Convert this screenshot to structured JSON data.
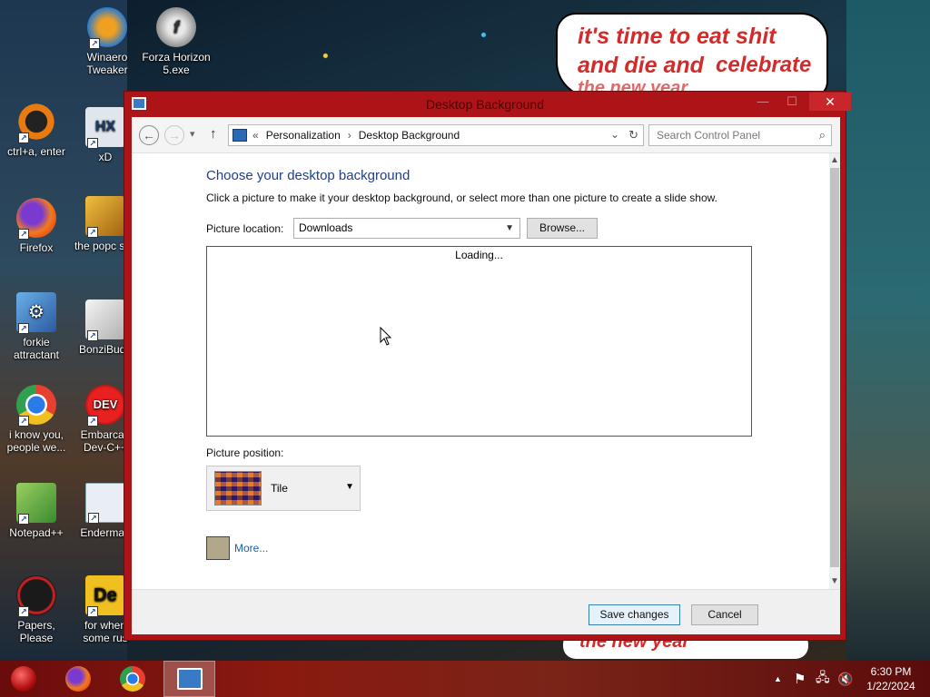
{
  "desktop": {
    "meme_text_line1": "it's time to eat shit",
    "meme_text_line2": "and die and",
    "meme_text_line2b": "celebrate",
    "meme_text_line3": "the new year",
    "meme_bottom_text": "the new year",
    "icons": [
      {
        "label": "Winaero Tweaker",
        "icon": "winaero-icon"
      },
      {
        "label": "Forza Horizon 5.exe",
        "icon": "flash-icon"
      },
      {
        "label": "ctrl+a, enter",
        "icon": "ring-icon"
      },
      {
        "label": "xD",
        "icon": "hxd-icon"
      },
      {
        "label": "Firefox",
        "icon": "firefox-icon"
      },
      {
        "label": "the popc shit",
        "icon": "folder-icon"
      },
      {
        "label": "forkie attractant",
        "icon": "settings-icon"
      },
      {
        "label": "BonziBudd",
        "icon": "bonzi-icon"
      },
      {
        "label": "i know you, people we...",
        "icon": "chrome-icon"
      },
      {
        "label": "Embarcad Dev-C++",
        "icon": "devcpp-icon"
      },
      {
        "label": "Notepad++",
        "icon": "notepad-icon"
      },
      {
        "label": "Enderman",
        "icon": "app-icon"
      },
      {
        "label": "Papers, Please",
        "icon": "papers-icon"
      },
      {
        "label": "for when some rus",
        "icon": "de-icon"
      }
    ]
  },
  "window": {
    "title": "Desktop Background",
    "close_glyph": "✕",
    "minimize_glyph": "—",
    "maximize_glyph": "☐",
    "nav": {
      "back_glyph": "←",
      "forward_glyph": "→",
      "recent_glyph": "▾",
      "up_glyph": "↑",
      "address_prefix": "«",
      "breadcrumb": [
        "Personalization",
        "Desktop Background"
      ],
      "breadcrumb_sep": "›",
      "dropdown_glyph": "⌄",
      "refresh_glyph": "↻",
      "search_placeholder": "Search Control Panel",
      "search_glyph": "⌕"
    },
    "heading": "Choose your desktop background",
    "description": "Click a picture to make it your desktop background, or select more than one picture to create a slide show.",
    "picture_location_label": "Picture location:",
    "picture_location_value": "Downloads",
    "browse_label": "Browse...",
    "gallery_status": "Loading...",
    "picture_position_label": "Picture position:",
    "picture_position_value": "Tile",
    "more_label": "More...",
    "swatch_color": "#b0a888",
    "save_label": "Save changes",
    "cancel_label": "Cancel"
  },
  "taskbar": {
    "items": [
      {
        "name": "start-button",
        "icon": "start-ornament-icon"
      },
      {
        "name": "firefox",
        "icon": "firefox-icon"
      },
      {
        "name": "chrome",
        "icon": "chrome-icon"
      },
      {
        "name": "control-panel",
        "icon": "control-panel-icon",
        "active": true
      }
    ],
    "tray_glyphs": {
      "up": "▲",
      "flag": "⚑",
      "network": "🖧",
      "volume": "🔇"
    },
    "time": "6:30 PM",
    "date": "1/22/2024"
  },
  "colors": {
    "window_frame": "#ad1418",
    "heading": "#1e3f8a",
    "link": "#1a5fb4",
    "close_button": "#c8262b",
    "taskbar": "#7a1810"
  }
}
